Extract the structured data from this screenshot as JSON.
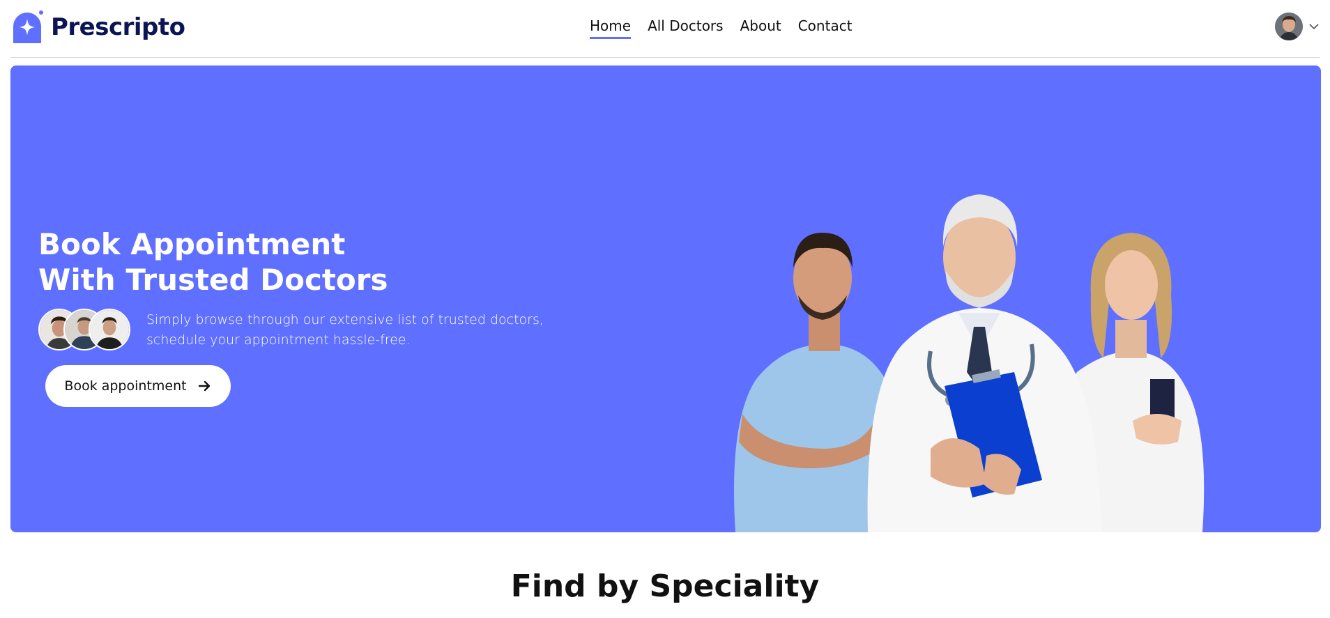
{
  "brand": {
    "name": "Prescripto",
    "accent": "#5f6fff",
    "dark": "#0b1455"
  },
  "nav": {
    "links": [
      {
        "label": "Home",
        "active": true
      },
      {
        "label": "All Doctors",
        "active": false
      },
      {
        "label": "About",
        "active": false
      },
      {
        "label": "Contact",
        "active": false
      }
    ],
    "profile_icon": "user-avatar",
    "dropdown_icon": "chevron-down-icon"
  },
  "hero": {
    "title_line1": "Book Appointment",
    "title_line2": "With Trusted Doctors",
    "desc_line1": "Simply browse through our extensive list of trusted doctors,",
    "desc_line2": "schedule your appointment hassle-free.",
    "cta_label": "Book appointment",
    "cta_icon": "arrow-right-icon",
    "background": "#5f6fff"
  },
  "speciality": {
    "title": "Find by Speciality"
  }
}
